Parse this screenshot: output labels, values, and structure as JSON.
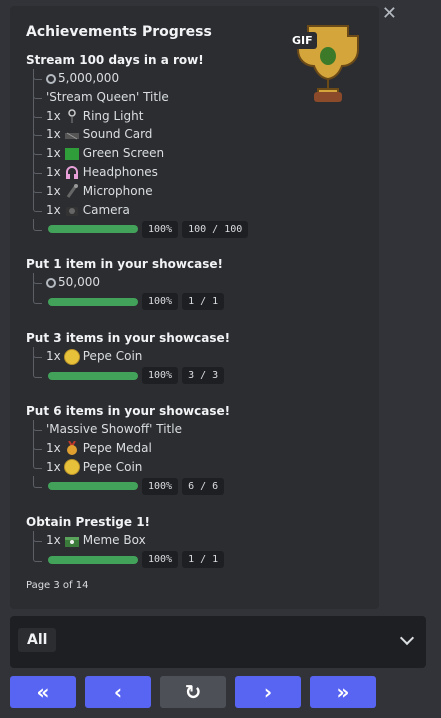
{
  "header": {
    "title": "Achievements Progress",
    "gif_label": "GIF"
  },
  "sections": [
    {
      "title": "Stream 100 days in a row!",
      "rows": [
        {
          "qty": "",
          "icon": "coin-currency-icon",
          "label": "5,000,000"
        },
        {
          "qty": "",
          "icon": "",
          "label": "'Stream Queen' Title"
        },
        {
          "qty": "1x",
          "icon": "ring-light-icon",
          "label": "Ring Light"
        },
        {
          "qty": "1x",
          "icon": "sound-card-icon",
          "label": "Sound Card"
        },
        {
          "qty": "1x",
          "icon": "green-screen-icon",
          "label": "Green Screen"
        },
        {
          "qty": "1x",
          "icon": "headphones-icon",
          "label": "Headphones"
        },
        {
          "qty": "1x",
          "icon": "microphone-icon",
          "label": "Microphone"
        },
        {
          "qty": "1x",
          "icon": "camera-icon",
          "label": "Camera"
        }
      ],
      "progress": 1.0,
      "percent": "100%",
      "count": "100 / 100"
    },
    {
      "title": "Put 1 item in your showcase!",
      "rows": [
        {
          "qty": "",
          "icon": "coin-currency-icon",
          "label": "50,000"
        }
      ],
      "progress": 1.0,
      "percent": "100%",
      "count": "1 / 1"
    },
    {
      "title": "Put 3 items in your showcase!",
      "rows": [
        {
          "qty": "1x",
          "icon": "pepe-coin-icon",
          "label": "Pepe Coin"
        }
      ],
      "progress": 1.0,
      "percent": "100%",
      "count": "3 / 3"
    },
    {
      "title": "Put 6 items in your showcase!",
      "rows": [
        {
          "qty": "",
          "icon": "",
          "label": "'Massive Showoff' Title"
        },
        {
          "qty": "1x",
          "icon": "pepe-medal-icon",
          "label": "Pepe Medal"
        },
        {
          "qty": "1x",
          "icon": "pepe-coin-icon",
          "label": "Pepe Coin"
        }
      ],
      "progress": 1.0,
      "percent": "100%",
      "count": "6 / 6"
    },
    {
      "title": "Obtain Prestige 1!",
      "rows": [
        {
          "qty": "1x",
          "icon": "meme-box-icon",
          "label": "Meme Box"
        }
      ],
      "progress": 1.0,
      "percent": "100%",
      "count": "1 / 1"
    }
  ],
  "footer": {
    "page": "Page 3 of 14"
  },
  "filter": {
    "selected": "All"
  },
  "nav": {
    "first": "«",
    "prev": "‹",
    "refresh": "↻",
    "next": "›",
    "last": "»"
  },
  "colors": {
    "progress": "#43a25a",
    "button": "#5865f2",
    "button_gray": "#4e5058",
    "bg": "#313338",
    "card": "#2b2d31"
  }
}
